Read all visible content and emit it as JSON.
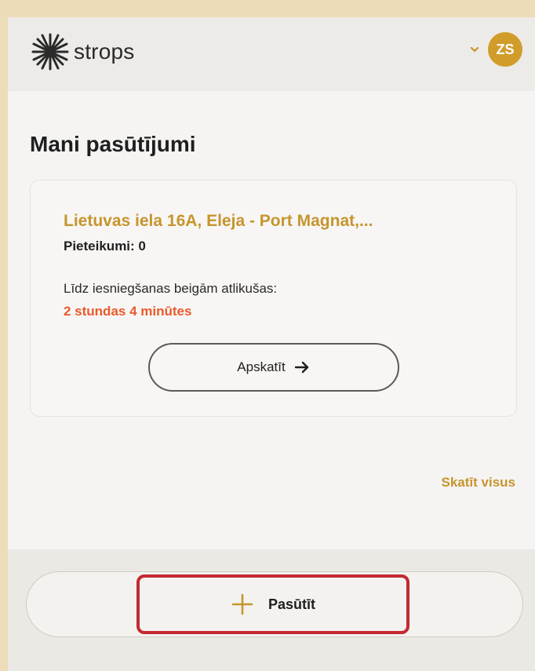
{
  "header": {
    "brand": "strops",
    "avatar_initials": "ZS",
    "menu_icon": "chevron-down-icon",
    "logo_icon": "star-burst-icon"
  },
  "main": {
    "title": "Mani pasūtījumi",
    "order": {
      "address": "Lietuvas iela 16A, Eleja - Port Magnat,...",
      "applications": "Pieteikumi: 0",
      "deadline_label": "Līdz iesniegšanas beigām atlikušas:",
      "deadline_value": "2 stundas 4 minūtes",
      "view_label": "Apskatīt",
      "view_icon": "arrow-right-icon"
    },
    "see_all": "Skatīt visus"
  },
  "footer": {
    "order_label": "Pasūtīt",
    "order_icon": "plus-icon"
  },
  "colors": {
    "accent": "#c6952e",
    "avatar": "#d19c2a",
    "urgent": "#ea5a2c",
    "highlight": "#c22a30",
    "outer_background": "#ecdcb8"
  }
}
